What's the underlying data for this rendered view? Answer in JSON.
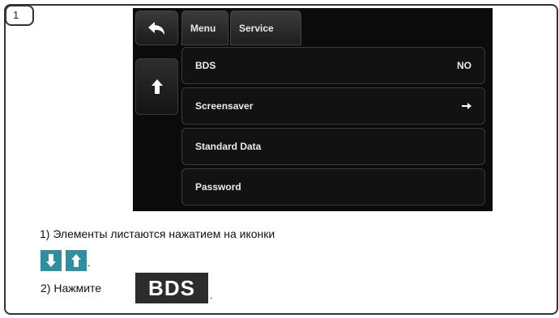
{
  "step_badge": "1",
  "screen": {
    "tabs": [
      {
        "label": "Menu"
      },
      {
        "label": "Service"
      }
    ],
    "items": [
      {
        "label": "BDS",
        "value": "NO"
      },
      {
        "label": "Screensaver",
        "value": ""
      },
      {
        "label": "Standard Data",
        "value": ""
      },
      {
        "label": "Password",
        "value": ""
      }
    ],
    "icons": {
      "back": "back-arrow-icon",
      "up": "up-arrow-icon",
      "forward": "forward-arrow-icon"
    }
  },
  "instructions": {
    "line1": "1) Элементы листаются нажатием на иконки",
    "line1_end": ".",
    "line2": "2) Нажмите",
    "line2_button": "BDS",
    "line2_end": "."
  },
  "colors": {
    "screen_bg": "#0b0b0b",
    "tile_teal": "#2f8f9e",
    "tile_dark": "#2c2c2c"
  }
}
